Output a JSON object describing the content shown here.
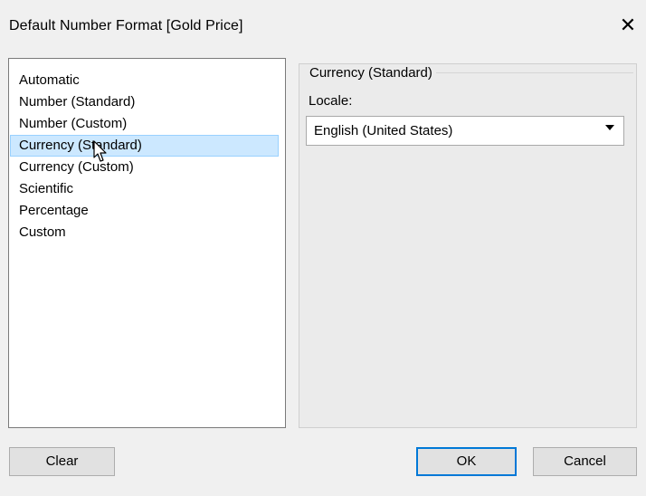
{
  "dialog": {
    "title": "Default Number Format [Gold Price]",
    "close_glyph": "✕"
  },
  "format_list": {
    "items": [
      {
        "label": "Automatic"
      },
      {
        "label": "Number (Standard)"
      },
      {
        "label": "Number (Custom)"
      },
      {
        "label": "Currency (Standard)",
        "selected": true
      },
      {
        "label": "Currency (Custom)"
      },
      {
        "label": "Scientific"
      },
      {
        "label": "Percentage"
      },
      {
        "label": "Custom"
      }
    ]
  },
  "settings": {
    "group_title": "Currency (Standard)",
    "locale_label": "Locale:",
    "locale_value": "English (United States)"
  },
  "buttons": {
    "clear": "Clear",
    "ok": "OK",
    "cancel": "Cancel"
  },
  "colors": {
    "selection_bg": "#cce8ff",
    "default_button_border": "#0078d7"
  },
  "icons": {
    "close": "close-icon",
    "dropdown": "dropdown-arrow-icon",
    "cursor": "mouse-cursor-icon"
  }
}
